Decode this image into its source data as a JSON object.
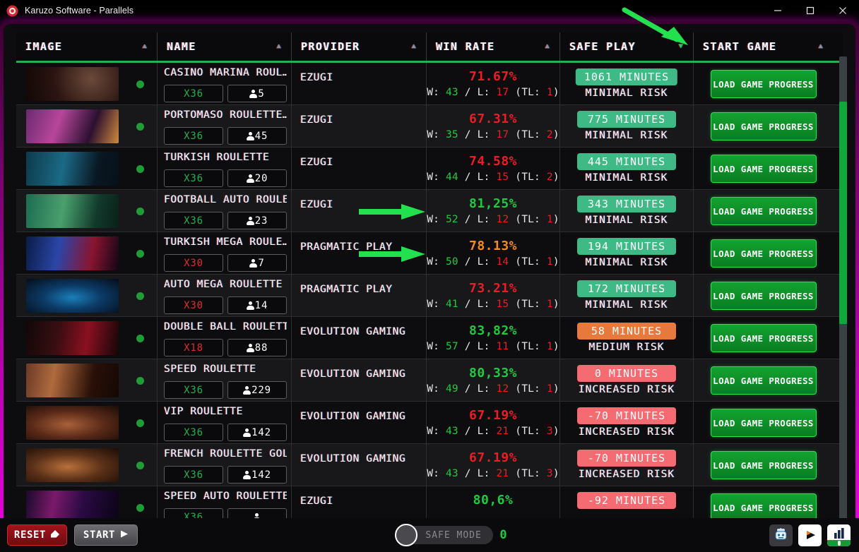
{
  "window": {
    "title": "Karuzo Software - Parallels",
    "icon": "app-logo-icon",
    "minimize": "minimize-icon",
    "maximize": "maximize-icon",
    "close": "close-icon"
  },
  "table": {
    "columns": [
      {
        "label": "IMAGE",
        "sort": "asc",
        "active": false
      },
      {
        "label": "NAME",
        "sort": "asc",
        "active": false
      },
      {
        "label": "PROVIDER",
        "sort": "asc",
        "active": false
      },
      {
        "label": "WIN RATE",
        "sort": "asc",
        "active": false
      },
      {
        "label": "SAFE PLAY",
        "sort": "desc",
        "active": true
      },
      {
        "label": "START GAME",
        "sort": "asc",
        "active": false
      }
    ],
    "start_button_label": "LOAD GAME PROGRESS",
    "rows": [
      {
        "name": "CASINO MARINA ROUL…",
        "multiplier": "X36",
        "multiplier_level": "hi",
        "players": "5",
        "provider": "EZUGI",
        "win_rate": "71.67%",
        "win_rate_level": "bad",
        "wins": "43",
        "losses": "17",
        "tl": "1",
        "safe_minutes": "1061 MINUTES",
        "risk": "MINIMAL RISK",
        "risk_level": "low",
        "online": true
      },
      {
        "name": "PORTOMASO ROULETTE…",
        "multiplier": "X36",
        "multiplier_level": "hi",
        "players": "45",
        "provider": "EZUGI",
        "win_rate": "67.31%",
        "win_rate_level": "bad",
        "wins": "35",
        "losses": "17",
        "tl": "2",
        "safe_minutes": "775 MINUTES",
        "risk": "MINIMAL RISK",
        "risk_level": "low",
        "online": true
      },
      {
        "name": "TURKISH ROULETTE",
        "multiplier": "X36",
        "multiplier_level": "hi",
        "players": "20",
        "provider": "EZUGI",
        "win_rate": "74.58%",
        "win_rate_level": "bad",
        "wins": "44",
        "losses": "15",
        "tl": "2",
        "safe_minutes": "445 MINUTES",
        "risk": "MINIMAL RISK",
        "risk_level": "low",
        "online": true
      },
      {
        "name": "FOOTBALL AUTO ROULE…",
        "multiplier": "X36",
        "multiplier_level": "hi",
        "players": "23",
        "provider": "EZUGI",
        "win_rate": "81,25%",
        "win_rate_level": "good",
        "wins": "52",
        "losses": "12",
        "tl": "1",
        "safe_minutes": "343 MINUTES",
        "risk": "MINIMAL RISK",
        "risk_level": "low",
        "online": true
      },
      {
        "name": "TURKISH MEGA ROULE…",
        "multiplier": "X30",
        "multiplier_level": "lo",
        "players": "7",
        "provider": "PRAGMATIC PLAY",
        "win_rate": "78.13%",
        "win_rate_level": "mid",
        "wins": "50",
        "losses": "14",
        "tl": "1",
        "safe_minutes": "194 MINUTES",
        "risk": "MINIMAL RISK",
        "risk_level": "low",
        "online": true
      },
      {
        "name": "AUTO MEGA ROULETTE",
        "multiplier": "X30",
        "multiplier_level": "lo",
        "players": "14",
        "provider": "PRAGMATIC PLAY",
        "win_rate": "73.21%",
        "win_rate_level": "bad",
        "wins": "41",
        "losses": "15",
        "tl": "1",
        "safe_minutes": "172 MINUTES",
        "risk": "MINIMAL RISK",
        "risk_level": "low",
        "online": true
      },
      {
        "name": "DOUBLE BALL ROULETTE",
        "multiplier": "X18",
        "multiplier_level": "lo",
        "players": "88",
        "provider": "EVOLUTION GAMING",
        "win_rate": "83,82%",
        "win_rate_level": "good",
        "wins": "57",
        "losses": "11",
        "tl": "1",
        "safe_minutes": "58 MINUTES",
        "risk": "MEDIUM RISK",
        "risk_level": "med",
        "online": true
      },
      {
        "name": "SPEED ROULETTE",
        "multiplier": "X36",
        "multiplier_level": "hi",
        "players": "229",
        "provider": "EVOLUTION GAMING",
        "win_rate": "80,33%",
        "win_rate_level": "good",
        "wins": "49",
        "losses": "12",
        "tl": "1",
        "safe_minutes": "0 MINUTES",
        "risk": "INCREASED RISK",
        "risk_level": "high",
        "online": true
      },
      {
        "name": "VIP ROULETTE",
        "multiplier": "X36",
        "multiplier_level": "hi",
        "players": "142",
        "provider": "EVOLUTION GAMING",
        "win_rate": "67.19%",
        "win_rate_level": "bad",
        "wins": "43",
        "losses": "21",
        "tl": "3",
        "safe_minutes": "-70 MINUTES",
        "risk": "INCREASED RISK",
        "risk_level": "high",
        "online": true
      },
      {
        "name": "FRENCH ROULETTE GOLD",
        "multiplier": "X36",
        "multiplier_level": "hi",
        "players": "142",
        "provider": "EVOLUTION GAMING",
        "win_rate": "67.19%",
        "win_rate_level": "bad",
        "wins": "43",
        "losses": "21",
        "tl": "3",
        "safe_minutes": "-70 MINUTES",
        "risk": "INCREASED RISK",
        "risk_level": "high",
        "online": true
      },
      {
        "name": "SPEED AUTO ROULETTE",
        "multiplier": "X36",
        "multiplier_level": "hi",
        "players": "",
        "provider": "EZUGI",
        "win_rate": "80,6%",
        "win_rate_level": "good",
        "wins": "",
        "losses": "",
        "tl": "",
        "safe_minutes": "-92 MINUTES",
        "risk": "",
        "risk_level": "high",
        "online": true
      }
    ]
  },
  "bottom_bar": {
    "reset_label": "RESET",
    "reset_icon": "eraser-icon",
    "start_label": "START",
    "start_icon": "play-triangle-icon",
    "safe_mode_label": "SAFE MODE",
    "safe_mode_enabled": false,
    "safe_mode_count": "0",
    "buttons": [
      {
        "icon": "robot-icon",
        "style": "dark"
      },
      {
        "icon": "play-icon",
        "style": "light"
      },
      {
        "icon": "bar-chart-icon",
        "style": "light"
      }
    ]
  },
  "annotations": {
    "arrow_to_safe_play_sort": "green-arrow-icon",
    "arrow_row_football": "green-arrow-icon",
    "arrow_row_turkish_mega": "green-arrow-icon"
  },
  "colors": {
    "accent_green": "#22b14c",
    "neon_border": "#e600dd",
    "risk_low": "#3fba86",
    "risk_medium": "#e8793c",
    "risk_high": "#f56b72"
  }
}
